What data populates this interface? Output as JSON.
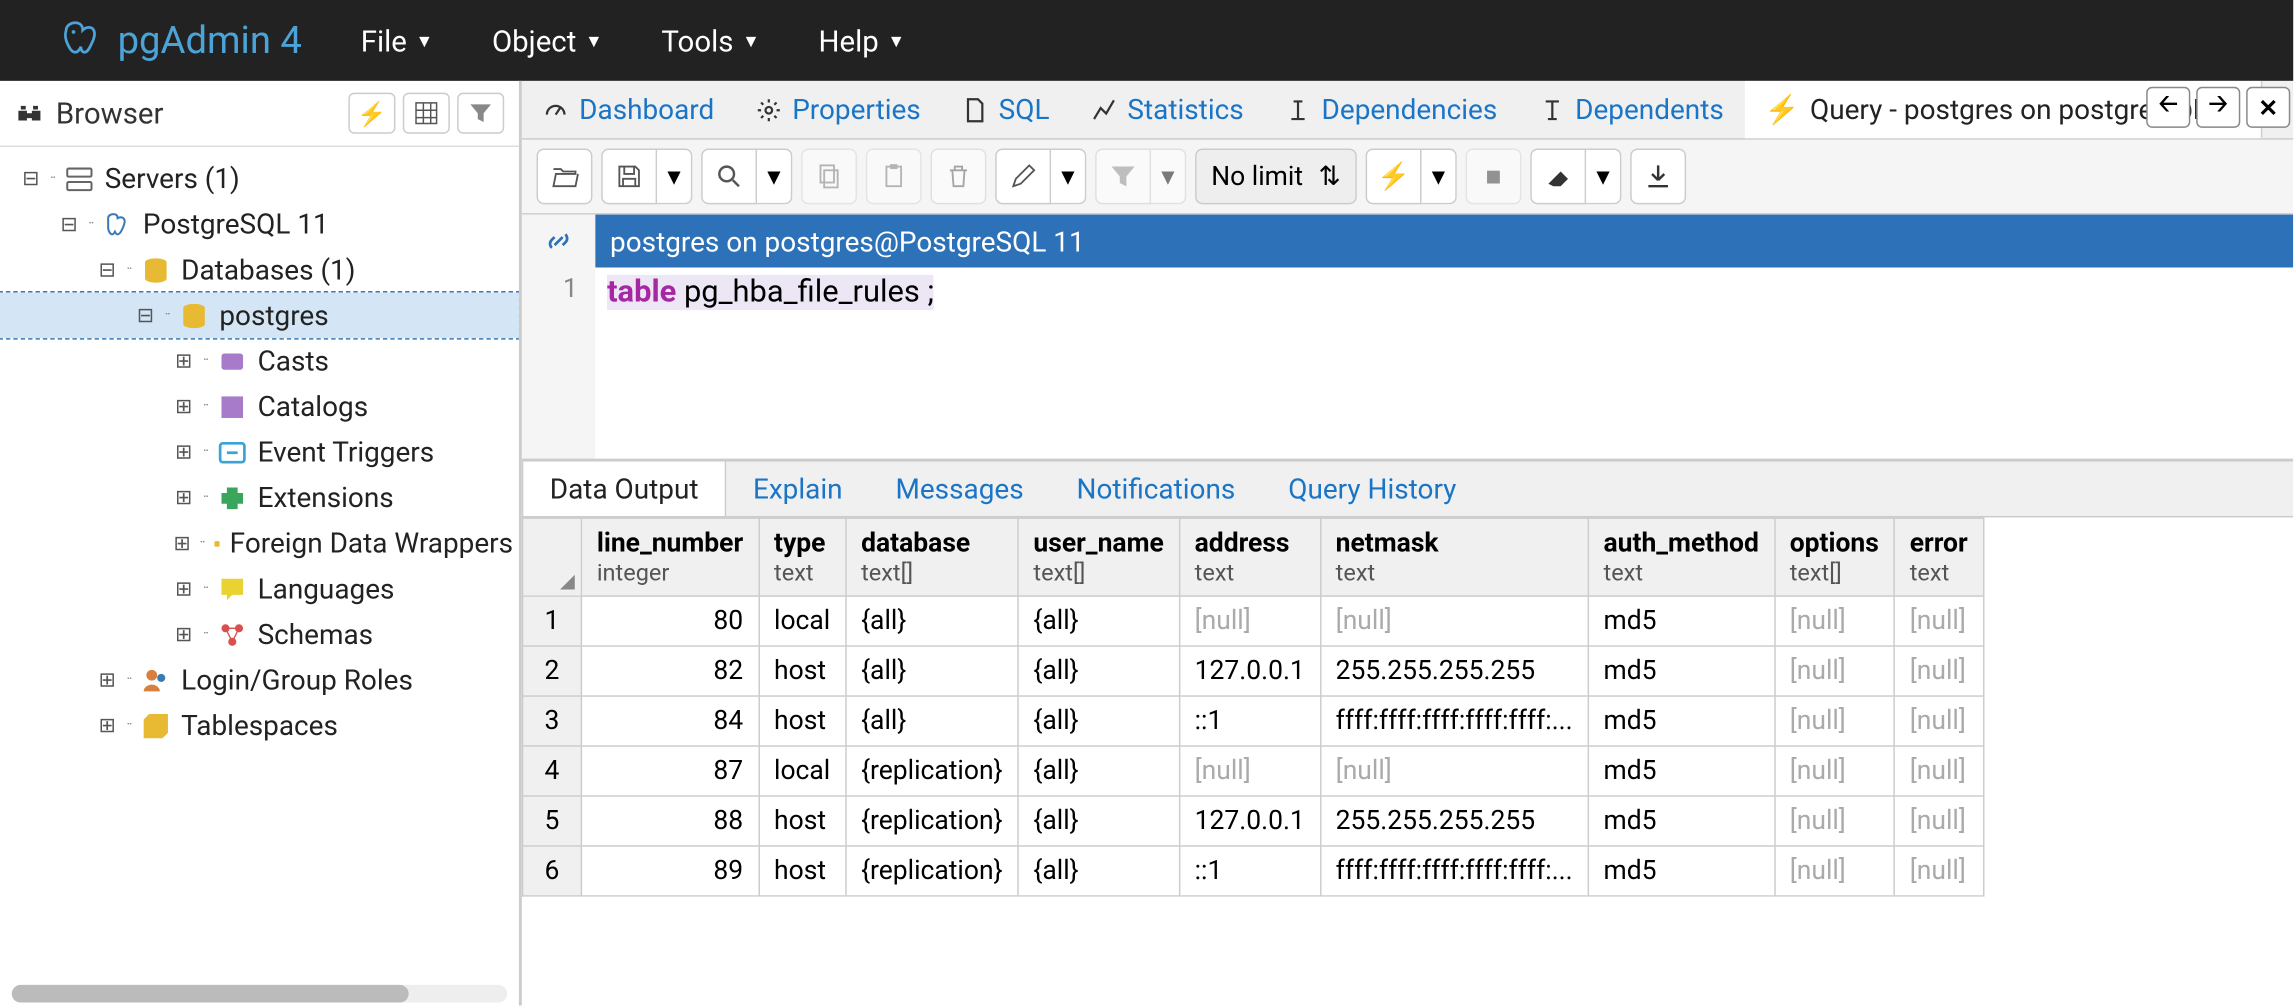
{
  "app": {
    "title": "pgAdmin 4"
  },
  "menu": {
    "file": "File",
    "object": "Object",
    "tools": "Tools",
    "help": "Help"
  },
  "sidebar": {
    "title": "Browser",
    "tree": {
      "servers": "Servers (1)",
      "pg": "PostgreSQL 11",
      "dbs": "Databases (1)",
      "db": "postgres",
      "casts": "Casts",
      "catalogs": "Catalogs",
      "event_triggers": "Event Triggers",
      "extensions": "Extensions",
      "fdw": "Foreign Data Wrappers",
      "languages": "Languages",
      "schemas": "Schemas",
      "roles": "Login/Group Roles",
      "tablespaces": "Tablespaces"
    }
  },
  "tabs": {
    "dashboard": "Dashboard",
    "properties": "Properties",
    "sql": "SQL",
    "statistics": "Statistics",
    "dependencies": "Dependencies",
    "dependents": "Dependents",
    "query": "Query - postgres on postgres@Pos"
  },
  "toolbar": {
    "no_limit": "No limit"
  },
  "conn": {
    "label": "postgres on postgres@PostgreSQL 11"
  },
  "editor": {
    "line1": "1",
    "kw": "table",
    "rest": " pg_hba_file_rules ;"
  },
  "results_tabs": {
    "data_output": "Data Output",
    "explain": "Explain",
    "messages": "Messages",
    "notifications": "Notifications",
    "history": "Query History"
  },
  "grid": {
    "cols": [
      {
        "name": "line_number",
        "type": "integer"
      },
      {
        "name": "type",
        "type": "text"
      },
      {
        "name": "database",
        "type": "text[]"
      },
      {
        "name": "user_name",
        "type": "text[]"
      },
      {
        "name": "address",
        "type": "text"
      },
      {
        "name": "netmask",
        "type": "text"
      },
      {
        "name": "auth_method",
        "type": "text"
      },
      {
        "name": "options",
        "type": "text[]"
      },
      {
        "name": "error",
        "type": "text"
      }
    ],
    "rows": [
      {
        "n": "1",
        "line_number": "80",
        "type": "local",
        "database": "{all}",
        "user_name": "{all}",
        "address": "[null]",
        "netmask": "[null]",
        "auth_method": "md5",
        "options": "[null]",
        "error": "[null]"
      },
      {
        "n": "2",
        "line_number": "82",
        "type": "host",
        "database": "{all}",
        "user_name": "{all}",
        "address": "127.0.0.1",
        "netmask": "255.255.255.255",
        "auth_method": "md5",
        "options": "[null]",
        "error": "[null]"
      },
      {
        "n": "3",
        "line_number": "84",
        "type": "host",
        "database": "{all}",
        "user_name": "{all}",
        "address": "::1",
        "netmask": "ffff:ffff:ffff:ffff:ffff:...",
        "auth_method": "md5",
        "options": "[null]",
        "error": "[null]"
      },
      {
        "n": "4",
        "line_number": "87",
        "type": "local",
        "database": "{replication}",
        "user_name": "{all}",
        "address": "[null]",
        "netmask": "[null]",
        "auth_method": "md5",
        "options": "[null]",
        "error": "[null]"
      },
      {
        "n": "5",
        "line_number": "88",
        "type": "host",
        "database": "{replication}",
        "user_name": "{all}",
        "address": "127.0.0.1",
        "netmask": "255.255.255.255",
        "auth_method": "md5",
        "options": "[null]",
        "error": "[null]"
      },
      {
        "n": "6",
        "line_number": "89",
        "type": "host",
        "database": "{replication}",
        "user_name": "{all}",
        "address": "::1",
        "netmask": "ffff:ffff:ffff:ffff:ffff:...",
        "auth_method": "md5",
        "options": "[null]",
        "error": "[null]"
      }
    ]
  }
}
